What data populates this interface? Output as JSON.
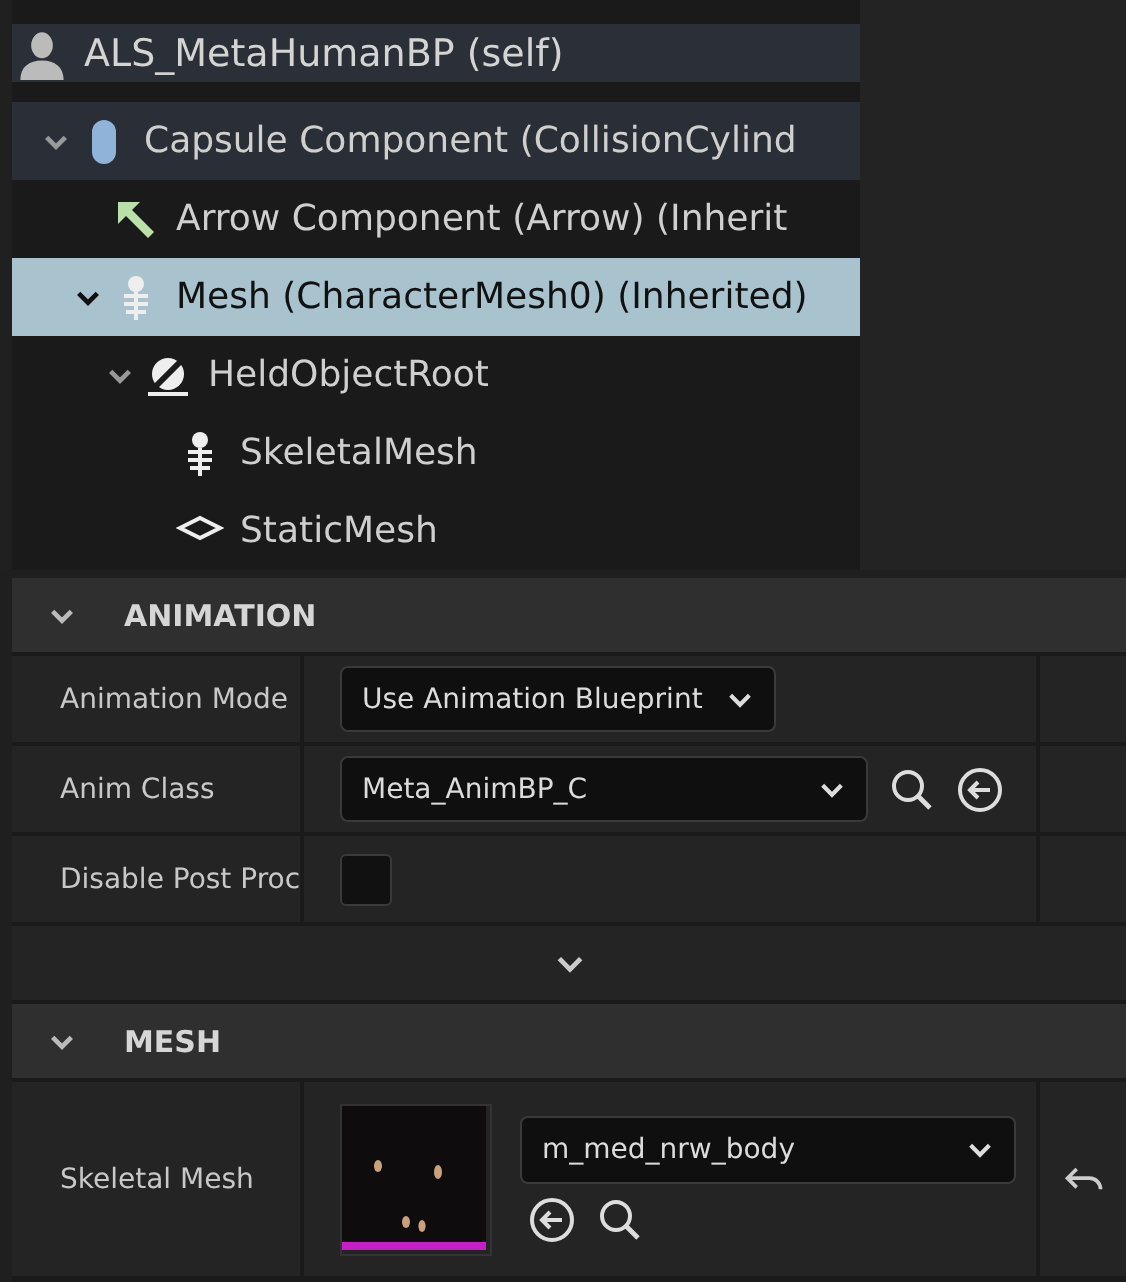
{
  "outliner": {
    "root": {
      "label": "ALS_MetaHumanBP (self)"
    },
    "tree": [
      {
        "label": "Capsule Component (CollisionCylind",
        "kind": "capsule",
        "expanded": true,
        "selected": false,
        "hovered": true,
        "children": [
          {
            "label": "Arrow Component (Arrow) (Inherit",
            "kind": "arrow",
            "selected": false,
            "hovered": false
          },
          {
            "label": "Mesh (CharacterMesh0) (Inherited)",
            "kind": "skeleton",
            "expanded": true,
            "selected": true,
            "hovered": false,
            "children": [
              {
                "label": "HeldObjectRoot",
                "kind": "scene",
                "expanded": true,
                "selected": false,
                "hovered": false,
                "children": [
                  {
                    "label": "SkeletalMesh",
                    "kind": "skeleton",
                    "selected": false,
                    "hovered": false
                  },
                  {
                    "label": "StaticMesh",
                    "kind": "cube",
                    "selected": false,
                    "hovered": false
                  }
                ]
              }
            ]
          }
        ]
      }
    ]
  },
  "details": {
    "sections": [
      {
        "title": "ANIMATION",
        "expanded": true,
        "advanced": {
          "expanded": false
        },
        "properties": [
          {
            "kind": "dropdown",
            "label": "Animation Mode",
            "value": "Use Animation Blueprint"
          },
          {
            "kind": "class-picker",
            "label": "Anim Class",
            "value": "Meta_AnimBP_C"
          },
          {
            "kind": "checkbox",
            "label": "Disable Post Proc",
            "checked": false
          }
        ]
      },
      {
        "title": "MESH",
        "expanded": true,
        "properties": [
          {
            "kind": "asset",
            "label": "Skeletal Mesh",
            "value": "m_med_nrw_body",
            "resettable": true
          }
        ]
      }
    ]
  }
}
